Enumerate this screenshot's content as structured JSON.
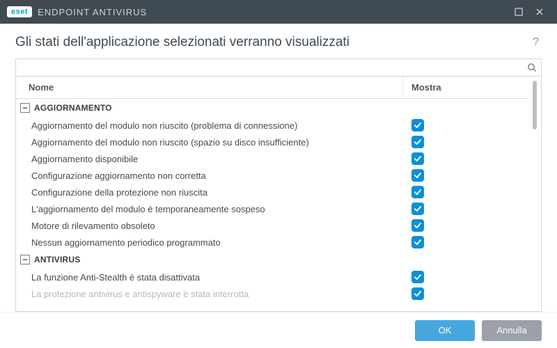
{
  "titlebar": {
    "logo_text": "eset",
    "product_name": "ENDPOINT ANTIVIRUS"
  },
  "header": {
    "title": "Gli stati dell'applicazione selezionati verranno visualizzati"
  },
  "search": {
    "placeholder": ""
  },
  "columns": {
    "name": "Nome",
    "show": "Mostra"
  },
  "groups": [
    {
      "label": "AGGIORNAMENTO",
      "expanded": true,
      "items": [
        {
          "label": "Aggiornamento del modulo non riuscito (problema di connessione)",
          "checked": true
        },
        {
          "label": "Aggiornamento del modulo non riuscito (spazio su disco insufficiente)",
          "checked": true
        },
        {
          "label": "Aggiornamento disponibile",
          "checked": true
        },
        {
          "label": "Configurazione aggiornamento non corretta",
          "checked": true
        },
        {
          "label": "Configurazione della protezione non riuscita",
          "checked": true
        },
        {
          "label": "L'aggiornamento del modulo è temporaneamente sospeso",
          "checked": true
        },
        {
          "label": "Motore di rilevamento obsoleto",
          "checked": true
        },
        {
          "label": "Nessun aggiornamento periodico programmato",
          "checked": true
        }
      ]
    },
    {
      "label": "ANTIVIRUS",
      "expanded": true,
      "items": [
        {
          "label": "La funzione Anti-Stealth è stata disattivata",
          "checked": true
        },
        {
          "label": "La protezione antivirus e antispyware è stata interrotta",
          "checked": true,
          "faded": true
        }
      ]
    }
  ],
  "footer": {
    "ok": "OK",
    "cancel": "Annulla"
  }
}
